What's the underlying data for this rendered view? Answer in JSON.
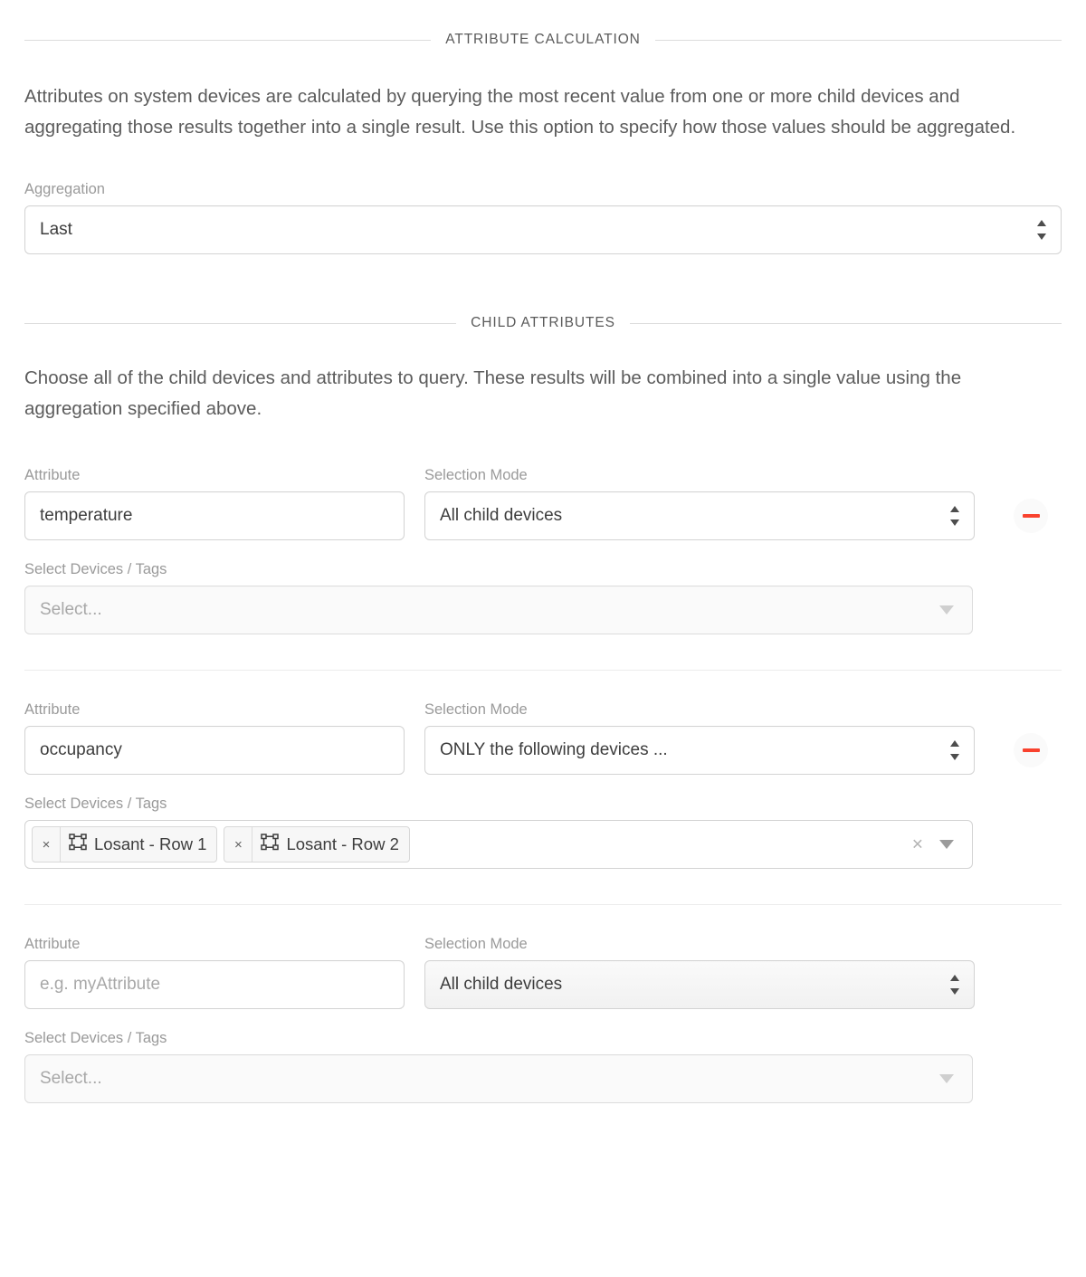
{
  "sections": {
    "attribute_calculation": {
      "title": "ATTRIBUTE CALCULATION",
      "description": "Attributes on system devices are calculated by querying the most recent value from one or more child devices and aggregating those results together into a single result. Use this option to specify how those values should be aggregated.",
      "aggregation": {
        "label": "Aggregation",
        "value": "Last"
      }
    },
    "child_attributes": {
      "title": "CHILD ATTRIBUTES",
      "description": "Choose all of the child devices and attributes to query. These results will be combined into a single value using the aggregation specified above.",
      "labels": {
        "attribute": "Attribute",
        "selection_mode": "Selection Mode",
        "devices_tags": "Select Devices / Tags"
      },
      "rows": [
        {
          "attribute_value": "temperature",
          "attribute_placeholder": "e.g. myAttribute",
          "selection_mode": "All child devices",
          "devices_placeholder": "Select...",
          "chips": [],
          "has_remove": true,
          "remove_label": "Remove attribute"
        },
        {
          "attribute_value": "occupancy",
          "attribute_placeholder": "e.g. myAttribute",
          "selection_mode": "ONLY the following devices ...",
          "devices_placeholder": "Select...",
          "chips": [
            {
              "remove": "×",
              "icon": "system-device-icon",
              "label": "Losant - Row 1"
            },
            {
              "remove": "×",
              "icon": "system-device-icon",
              "label": "Losant - Row 2"
            }
          ],
          "clear_all": "×",
          "has_remove": true,
          "remove_label": "Remove attribute"
        },
        {
          "attribute_value": "",
          "attribute_placeholder": "e.g. myAttribute",
          "selection_mode": "All child devices",
          "devices_placeholder": "Select...",
          "chips": [],
          "has_remove": false
        }
      ]
    }
  },
  "colors": {
    "accent_remove": "#f9422e",
    "text": "#4a4a4a",
    "label": "#9a9a9a",
    "border": "#d3d3d3"
  }
}
